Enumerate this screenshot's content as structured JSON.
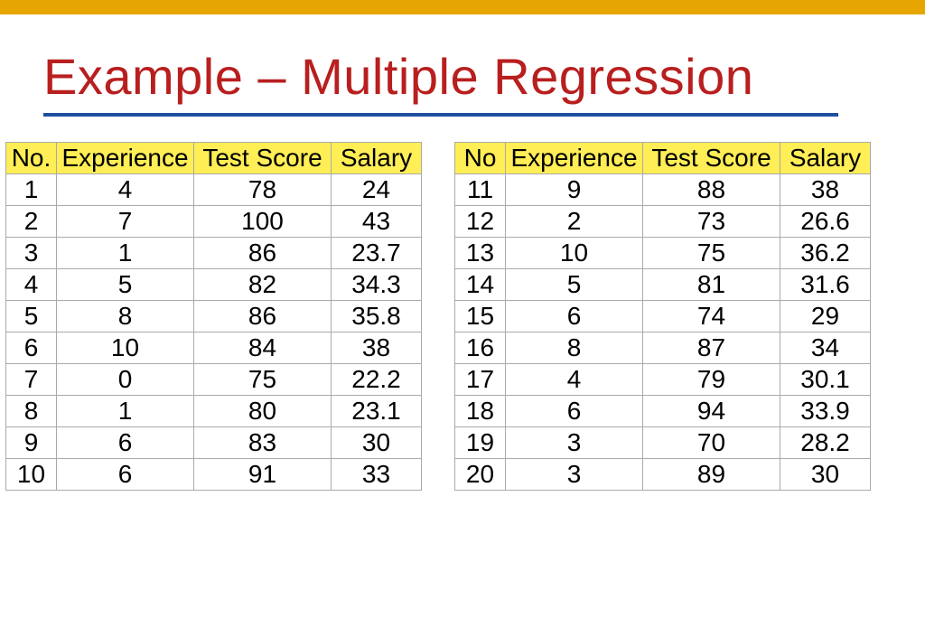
{
  "title": "Example – Multiple Regression",
  "table1": {
    "headers": {
      "no": "No.",
      "experience": "Experience",
      "testscore": "Test Score",
      "salary": "Salary"
    },
    "rows": [
      {
        "no": "1",
        "experience": "4",
        "testscore": "78",
        "salary": "24"
      },
      {
        "no": "2",
        "experience": "7",
        "testscore": "100",
        "salary": "43"
      },
      {
        "no": "3",
        "experience": "1",
        "testscore": "86",
        "salary": "23.7"
      },
      {
        "no": "4",
        "experience": "5",
        "testscore": "82",
        "salary": "34.3"
      },
      {
        "no": "5",
        "experience": "8",
        "testscore": "86",
        "salary": "35.8"
      },
      {
        "no": "6",
        "experience": "10",
        "testscore": "84",
        "salary": "38"
      },
      {
        "no": "7",
        "experience": "0",
        "testscore": "75",
        "salary": "22.2"
      },
      {
        "no": "8",
        "experience": "1",
        "testscore": "80",
        "salary": "23.1"
      },
      {
        "no": "9",
        "experience": "6",
        "testscore": "83",
        "salary": "30"
      },
      {
        "no": "10",
        "experience": "6",
        "testscore": "91",
        "salary": "33"
      }
    ]
  },
  "table2": {
    "headers": {
      "no": "No",
      "experience": "Experience",
      "testscore": "Test Score",
      "salary": "Salary"
    },
    "rows": [
      {
        "no": "11",
        "experience": "9",
        "testscore": "88",
        "salary": "38"
      },
      {
        "no": "12",
        "experience": "2",
        "testscore": "73",
        "salary": "26.6"
      },
      {
        "no": "13",
        "experience": "10",
        "testscore": "75",
        "salary": "36.2"
      },
      {
        "no": "14",
        "experience": "5",
        "testscore": "81",
        "salary": "31.6"
      },
      {
        "no": "15",
        "experience": "6",
        "testscore": "74",
        "salary": "29"
      },
      {
        "no": "16",
        "experience": "8",
        "testscore": "87",
        "salary": "34"
      },
      {
        "no": "17",
        "experience": "4",
        "testscore": "79",
        "salary": "30.1"
      },
      {
        "no": "18",
        "experience": "6",
        "testscore": "94",
        "salary": "33.9"
      },
      {
        "no": "19",
        "experience": "3",
        "testscore": "70",
        "salary": "28.2"
      },
      {
        "no": "20",
        "experience": "3",
        "testscore": "89",
        "salary": "30"
      }
    ]
  },
  "chart_data": [
    {
      "type": "table",
      "title": "Multiple Regression Dataset (rows 1–10)",
      "columns": [
        "No.",
        "Experience",
        "Test Score",
        "Salary"
      ],
      "rows": [
        [
          1,
          4,
          78,
          24
        ],
        [
          2,
          7,
          100,
          43
        ],
        [
          3,
          1,
          86,
          23.7
        ],
        [
          4,
          5,
          82,
          34.3
        ],
        [
          5,
          8,
          86,
          35.8
        ],
        [
          6,
          10,
          84,
          38
        ],
        [
          7,
          0,
          75,
          22.2
        ],
        [
          8,
          1,
          80,
          23.1
        ],
        [
          9,
          6,
          83,
          30
        ],
        [
          10,
          6,
          91,
          33
        ]
      ]
    },
    {
      "type": "table",
      "title": "Multiple Regression Dataset (rows 11–20)",
      "columns": [
        "No",
        "Experience",
        "Test Score",
        "Salary"
      ],
      "rows": [
        [
          11,
          9,
          88,
          38
        ],
        [
          12,
          2,
          73,
          26.6
        ],
        [
          13,
          10,
          75,
          36.2
        ],
        [
          14,
          5,
          81,
          31.6
        ],
        [
          15,
          6,
          74,
          29
        ],
        [
          16,
          8,
          87,
          34
        ],
        [
          17,
          4,
          79,
          30.1
        ],
        [
          18,
          6,
          94,
          33.9
        ],
        [
          19,
          3,
          70,
          28.2
        ],
        [
          20,
          3,
          89,
          30
        ]
      ]
    }
  ]
}
